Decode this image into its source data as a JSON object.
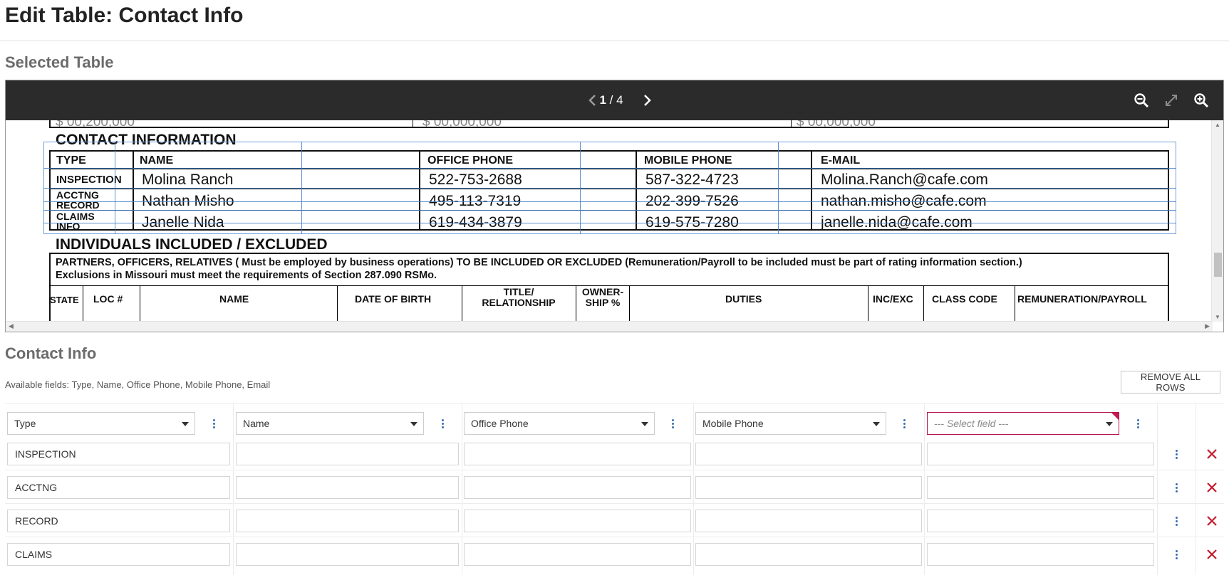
{
  "page": {
    "title": "Edit Table: Contact Info"
  },
  "selected_section": {
    "heading": "Selected Table"
  },
  "viewer": {
    "current_page": "1",
    "page_separator": " / ",
    "total_pages": "4",
    "icons": {
      "prev": "chevron-left-icon",
      "next": "chevron-right-icon",
      "zoom_out": "zoom-out-icon",
      "fit": "expand-icon",
      "zoom_in": "zoom-in-icon"
    }
  },
  "document": {
    "top_row_fragments": [
      "$ 00,200,000",
      "$ 00,000,000",
      "$ 00,000,000"
    ],
    "contact_heading": "CONTACT INFORMATION",
    "columns": [
      "TYPE",
      "NAME",
      "OFFICE PHONE",
      "MOBILE PHONE",
      "E-MAIL"
    ],
    "rows": [
      {
        "type": [
          "INSPECTION"
        ],
        "name": "Molina Ranch",
        "office": "522-753-2688",
        "mobile": "587-322-4723",
        "email": "Molina.Ranch@cafe.com"
      },
      {
        "type": [
          "ACCTNG",
          "RECORD"
        ],
        "name": "Nathan Misho",
        "office": "495-113-7319",
        "mobile": "202-399-7526",
        "email": "nathan.misho@cafe.com"
      },
      {
        "type": [
          "CLAIMS",
          "INFO"
        ],
        "name": "Janelle Nida",
        "office": "619-434-3879",
        "mobile": "619-575-7280",
        "email": "janelle.nida@cafe.com"
      }
    ],
    "individuals_heading": "INDIVIDUALS INCLUDED / EXCLUDED",
    "individuals_note_1": "PARTNERS, OFFICERS, RELATIVES ( Must be employed by business operations) TO BE INCLUDED OR EXCLUDED (Remuneration/Payroll to be included must be part of rating information section.)",
    "individuals_note_2": "Exclusions in Missouri must meet the requirements of Section 287.090 RSMo.",
    "individuals_columns": [
      "STATE",
      "LOC #",
      "NAME",
      "DATE OF BIRTH",
      "TITLE/ RELATIONSHIP",
      "OWNER- SHIP %",
      "DUTIES",
      "INC/EXC",
      "CLASS CODE",
      "REMUNERATION/PAYROLL"
    ]
  },
  "mapping": {
    "heading": "Contact Info",
    "available_fields": "Available fields: Type, Name, Office Phone, Mobile Phone, Email",
    "remove_all_label": "REMOVE ALL ROWS",
    "column_selects": [
      "Type",
      "Name",
      "Office Phone",
      "Mobile Phone",
      "--- Select field ---"
    ],
    "rows": [
      [
        "INSPECTION",
        "",
        "",
        "",
        ""
      ],
      [
        "ACCTNG",
        "",
        "",
        "",
        ""
      ],
      [
        "RECORD",
        "",
        "",
        "",
        ""
      ],
      [
        "CLAIMS",
        "",
        "",
        "",
        ""
      ]
    ],
    "colors": {
      "accent_blue": "#3a6fb0",
      "delete_red": "#c41a2a",
      "placeholder_border": "#b5114f"
    }
  }
}
